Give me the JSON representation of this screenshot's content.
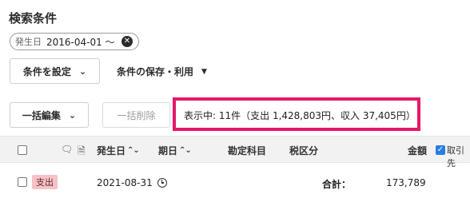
{
  "page": {
    "title": "検索条件"
  },
  "filter_chip": {
    "key": "発生日",
    "value": "2016-04-01 〜",
    "close_icon": "⊗"
  },
  "buttons": {
    "set_conditions": "条件を設定",
    "save_use": "条件の保存・利用",
    "bulk_edit": "一括編集",
    "bulk_delete": "一括削除"
  },
  "summary": {
    "text": "表示中: 11件（支出 1,428,803円、収入 37,405円）",
    "highlight_color": "#e5176a"
  },
  "table": {
    "headers": {
      "date": "発生日",
      "due": "期日",
      "account": "勘定科目",
      "tax": "税区分",
      "amount": "金額",
      "counterparty": "取引先"
    },
    "icons": [
      "comment-icon",
      "document-icon"
    ],
    "rows": [
      {
        "type_badge": "支出",
        "date": "2021-08-31",
        "total_label": "合計：",
        "amount": "173,789"
      }
    ]
  }
}
